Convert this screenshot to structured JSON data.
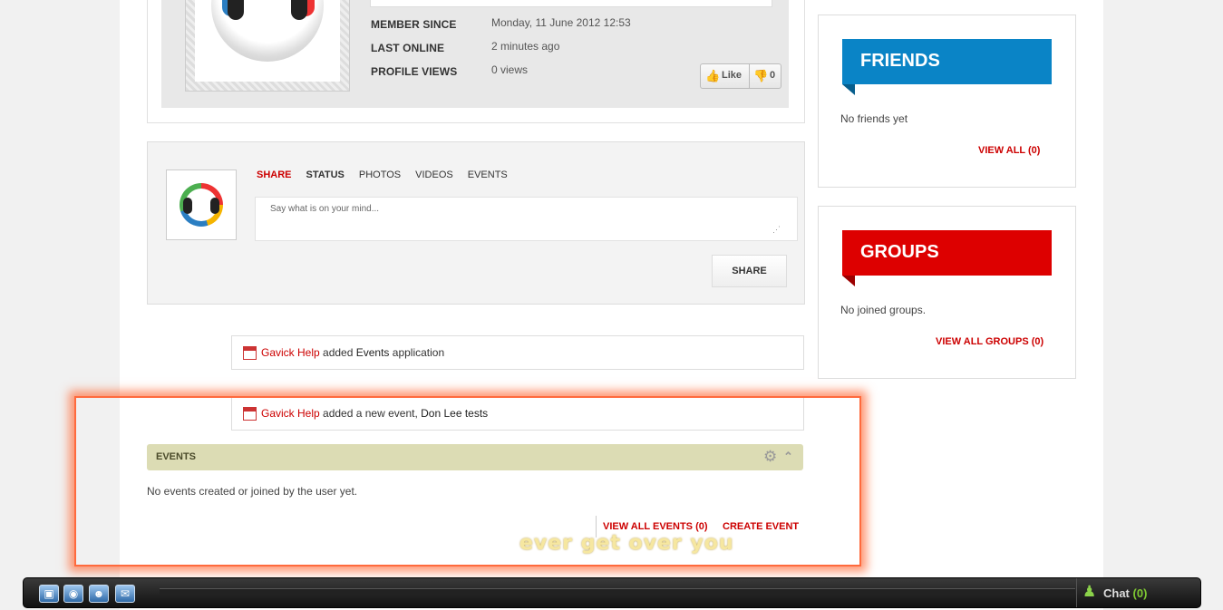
{
  "profile": {
    "member_since_label": "MEMBER SINCE",
    "member_since_value": "Monday, 11 June 2012 12:53",
    "last_online_label": "LAST ONLINE",
    "last_online_value": "2 minutes ago",
    "profile_views_label": "PROFILE VIEWS",
    "profile_views_value": "0 views",
    "like_label": "Like",
    "dislike_count": "0"
  },
  "share": {
    "tabs": [
      "SHARE",
      "STATUS",
      "PHOTOS",
      "VIDEOS",
      "EVENTS"
    ],
    "placeholder": "Say what is on your mind...",
    "button": "SHARE"
  },
  "activity": [
    {
      "user": "Gavick Help",
      "action": "added",
      "object": "Events",
      "suffix": "application"
    },
    {
      "user": "Gavick Help",
      "action": "added a new event,",
      "object": "Don Lee tests"
    }
  ],
  "events": {
    "title": "EVENTS",
    "empty": "No events created or joined by the user yet.",
    "view_all": "VIEW ALL EVENTS (0)",
    "create": "CREATE EVENT"
  },
  "caption": "ever get over you",
  "friends": {
    "title": "FRIENDS",
    "empty": "No friends yet",
    "view_all": "VIEW ALL (0)",
    "color": "#0a84c6"
  },
  "groups": {
    "title": "GROUPS",
    "empty": "No joined groups.",
    "view_all": "VIEW ALL GROUPS (0)",
    "color": "#dd0000"
  },
  "chatbar": {
    "icons": [
      "apps-icon",
      "video-icon",
      "users-icon",
      "mail-icon"
    ],
    "chat_label": "Chat",
    "chat_count": "(0)"
  }
}
